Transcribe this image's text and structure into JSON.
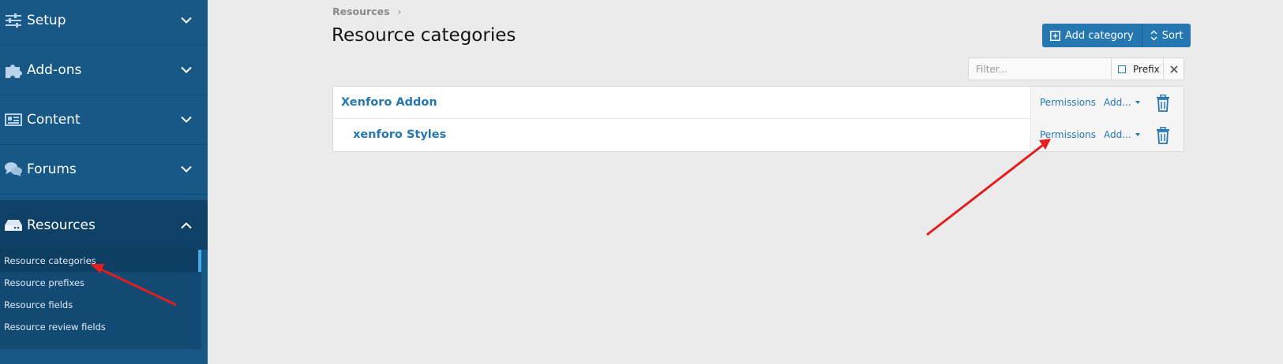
{
  "sidebar": {
    "sections": [
      {
        "label": "Setup",
        "icon": "sliders-icon",
        "expanded": false
      },
      {
        "label": "Add-ons",
        "icon": "puzzle-icon",
        "expanded": false
      },
      {
        "label": "Content",
        "icon": "content-icon",
        "expanded": false
      },
      {
        "label": "Forums",
        "icon": "comments-icon",
        "expanded": false
      },
      {
        "label": "Resources",
        "icon": "hard-drive-icon",
        "expanded": true
      }
    ],
    "subitems": [
      {
        "label": "Resource categories",
        "selected": true
      },
      {
        "label": "Resource prefixes",
        "selected": false
      },
      {
        "label": "Resource fields",
        "selected": false
      },
      {
        "label": "Resource review fields",
        "selected": false
      }
    ]
  },
  "breadcrumb": {
    "items": [
      "Resources"
    ],
    "separator": "›"
  },
  "page": {
    "title": "Resource categories"
  },
  "toolbar": {
    "add_label": "Add category",
    "sort_label": "Sort"
  },
  "filter": {
    "placeholder": "Filter...",
    "value": "",
    "prefix_label": "Prefix",
    "prefix_checked": false
  },
  "categories": [
    {
      "name": "Xenforo Addon",
      "level": 0,
      "permissions_label": "Permissions",
      "add_label": "Add..."
    },
    {
      "name": "xenforo Styles",
      "level": 1,
      "permissions_label": "Permissions",
      "add_label": "Add..."
    }
  ],
  "colors": {
    "sidebar_bg": "#185886",
    "sidebar_active_bg": "#0f4166",
    "accent": "#2577b1",
    "annotation_arrow": "#e31e1e",
    "page_bg": "#ebebeb"
  }
}
